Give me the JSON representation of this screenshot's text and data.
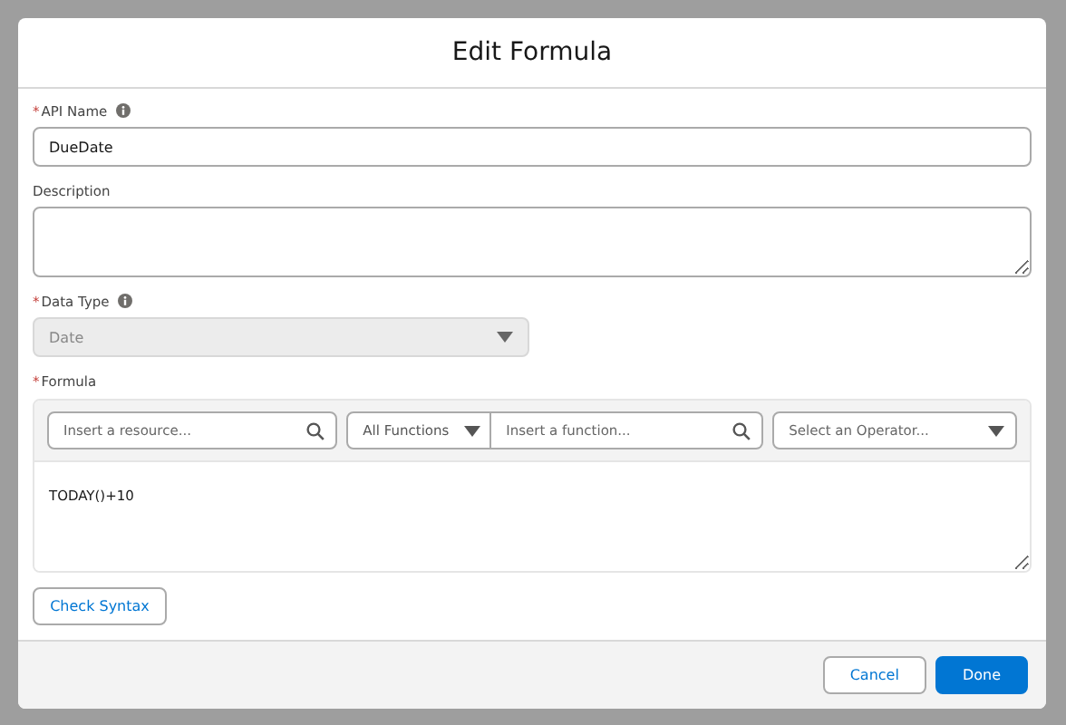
{
  "dialog": {
    "title": "Edit Formula"
  },
  "fields": [
    {
      "kind": "input",
      "label": "API Name",
      "required_mark": "*",
      "info": true,
      "value": "DueDate"
    },
    {
      "kind": "textarea",
      "label": "Description",
      "info": false
    },
    {
      "kind": "select",
      "label": "Data Type",
      "required_mark": "*",
      "info": true,
      "value": "Date",
      "disabled": true
    }
  ],
  "formula": {
    "label": "Formula",
    "required_mark": "*",
    "info": false,
    "resource_search": {
      "placeholder": "Insert a resource..."
    },
    "function_filter": {
      "value": "All Functions"
    },
    "function_search": {
      "placeholder": "Insert a function..."
    },
    "operator_select": {
      "placeholder": "Select an Operator..."
    },
    "value": "TODAY()+10"
  },
  "check_button": "Check Syntax",
  "footer": {
    "buttons": [
      {
        "label": "Cancel",
        "kind": "neutral"
      },
      {
        "label": "Done",
        "kind": "brand"
      }
    ]
  }
}
